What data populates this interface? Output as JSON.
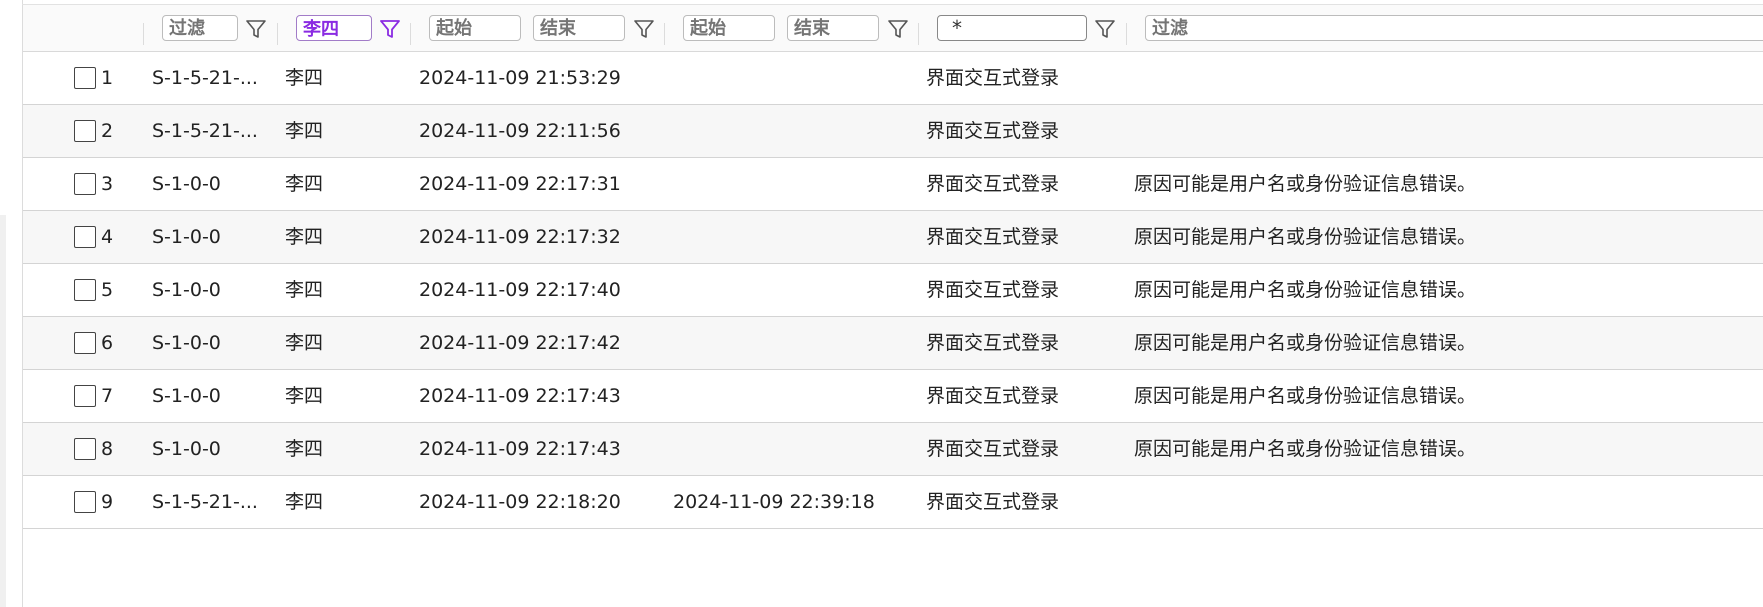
{
  "filters": {
    "sid_placeholder": "过滤",
    "user_value": "李四",
    "start_time_from_placeholder": "起始",
    "start_time_to_placeholder": "结束",
    "end_time_from_placeholder": "起始",
    "end_time_to_placeholder": "结束",
    "type_value": "*",
    "message_placeholder": "过滤",
    "active_filter_color": "#8a2be2"
  },
  "rows": [
    {
      "id": "1",
      "sid": "S-1-5-21-...",
      "user": "李四",
      "start": "2024-11-09 21:53:29",
      "end": "",
      "type": "界面交互式登录",
      "message": ""
    },
    {
      "id": "2",
      "sid": "S-1-5-21-...",
      "user": "李四",
      "start": "2024-11-09 22:11:56",
      "end": "",
      "type": "界面交互式登录",
      "message": ""
    },
    {
      "id": "3",
      "sid": "S-1-0-0",
      "user": "李四",
      "start": "2024-11-09 22:17:31",
      "end": "",
      "type": "界面交互式登录",
      "message": "原因可能是用户名或身份验证信息错误。"
    },
    {
      "id": "4",
      "sid": "S-1-0-0",
      "user": "李四",
      "start": "2024-11-09 22:17:32",
      "end": "",
      "type": "界面交互式登录",
      "message": "原因可能是用户名或身份验证信息错误。"
    },
    {
      "id": "5",
      "sid": "S-1-0-0",
      "user": "李四",
      "start": "2024-11-09 22:17:40",
      "end": "",
      "type": "界面交互式登录",
      "message": "原因可能是用户名或身份验证信息错误。"
    },
    {
      "id": "6",
      "sid": "S-1-0-0",
      "user": "李四",
      "start": "2024-11-09 22:17:42",
      "end": "",
      "type": "界面交互式登录",
      "message": "原因可能是用户名或身份验证信息错误。"
    },
    {
      "id": "7",
      "sid": "S-1-0-0",
      "user": "李四",
      "start": "2024-11-09 22:17:43",
      "end": "",
      "type": "界面交互式登录",
      "message": "原因可能是用户名或身份验证信息错误。"
    },
    {
      "id": "8",
      "sid": "S-1-0-0",
      "user": "李四",
      "start": "2024-11-09 22:17:43",
      "end": "",
      "type": "界面交互式登录",
      "message": "原因可能是用户名或身份验证信息错误。"
    },
    {
      "id": "9",
      "sid": "S-1-5-21-...",
      "user": "李四",
      "start": "2024-11-09 22:18:20",
      "end": "2024-11-09 22:39:18",
      "type": "界面交互式登录",
      "message": ""
    }
  ]
}
